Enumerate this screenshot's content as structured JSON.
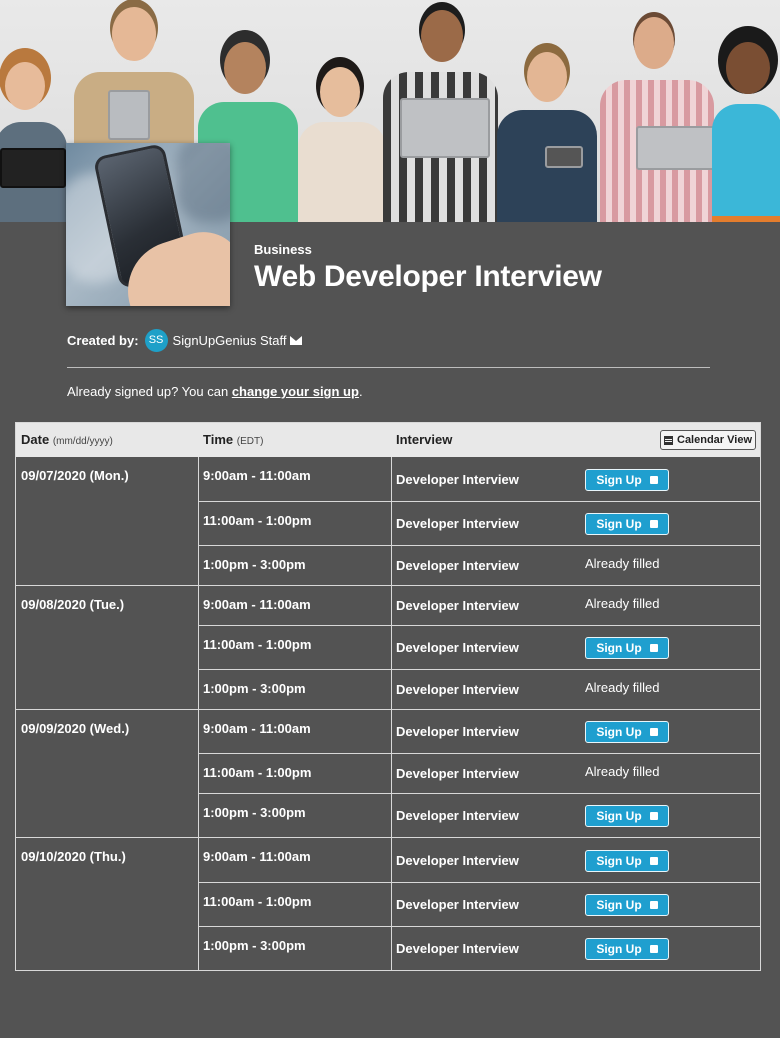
{
  "colors": {
    "background": "#535353",
    "signup_button": "#1f9fcf",
    "avatar": "#1ea0c8",
    "table_header": "#e8e8e8"
  },
  "header": {
    "category": "Business",
    "title": "Web Developer Interview",
    "created_by_label": "Created by:",
    "avatar_initials": "SS",
    "creator_name": "SignUpGenius Staff"
  },
  "notice": {
    "prefix": "Already signed up? You can",
    "link": "change your sign up",
    "suffix": "."
  },
  "table": {
    "date_header": "Date",
    "date_format": "(mm/dd/yyyy)",
    "time_header": "Time",
    "time_zone": "(EDT)",
    "interview_header": "Interview",
    "calendar_view_label": "Calendar View",
    "signup_label": "Sign Up",
    "days": [
      {
        "date": "09/07/2020 (Mon.)",
        "slots": [
          {
            "time": "9:00am - 11:00am",
            "interview": "Developer Interview",
            "status": "Sign Up"
          },
          {
            "time": "11:00am - 1:00pm",
            "interview": "Developer Interview",
            "status": "Sign Up"
          },
          {
            "time": "1:00pm - 3:00pm",
            "interview": "Developer Interview",
            "status": "Already filled"
          }
        ]
      },
      {
        "date": "09/08/2020 (Tue.)",
        "slots": [
          {
            "time": "9:00am - 11:00am",
            "interview": "Developer Interview",
            "status": "Already filled"
          },
          {
            "time": "11:00am - 1:00pm",
            "interview": "Developer Interview",
            "status": "Sign Up"
          },
          {
            "time": "1:00pm - 3:00pm",
            "interview": "Developer Interview",
            "status": "Already filled"
          }
        ]
      },
      {
        "date": "09/09/2020 (Wed.)",
        "slots": [
          {
            "time": "9:00am - 11:00am",
            "interview": "Developer Interview",
            "status": "Sign Up"
          },
          {
            "time": "11:00am - 1:00pm",
            "interview": "Developer Interview",
            "status": "Already filled"
          },
          {
            "time": "1:00pm - 3:00pm",
            "interview": "Developer Interview",
            "status": "Sign Up"
          }
        ]
      },
      {
        "date": "09/10/2020 (Thu.)",
        "slots": [
          {
            "time": "9:00am - 11:00am",
            "interview": "Developer Interview",
            "status": "Sign Up"
          },
          {
            "time": "11:00am - 1:00pm",
            "interview": "Developer Interview",
            "status": "Sign Up"
          },
          {
            "time": "1:00pm - 3:00pm",
            "interview": "Developer Interview",
            "status": "Sign Up"
          }
        ]
      }
    ]
  }
}
